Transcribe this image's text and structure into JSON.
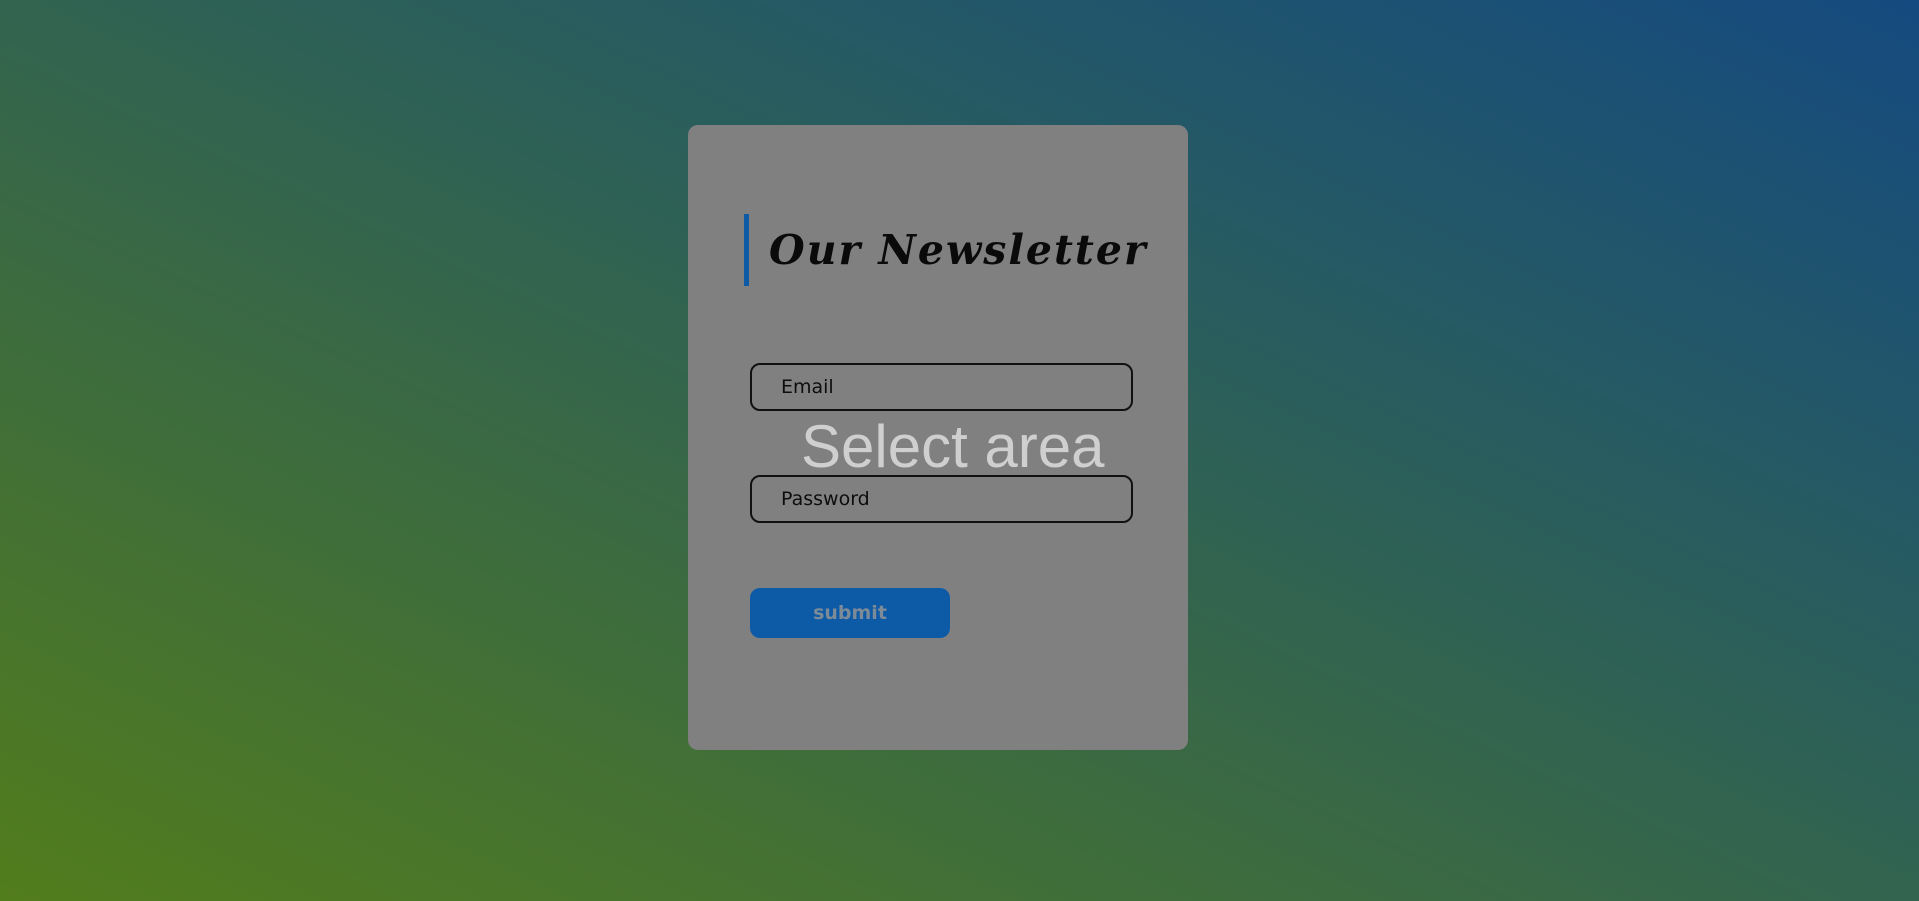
{
  "colors": {
    "accent": "#0d5aa7",
    "card_background": "#808080",
    "button_background": "#0d5aa7"
  },
  "newsletter": {
    "title": "Our Newsletter",
    "email": {
      "placeholder": "Email",
      "value": ""
    },
    "password": {
      "placeholder": "Password",
      "value": ""
    },
    "submit_label": "submit"
  },
  "overlay": {
    "label": "Select area"
  }
}
